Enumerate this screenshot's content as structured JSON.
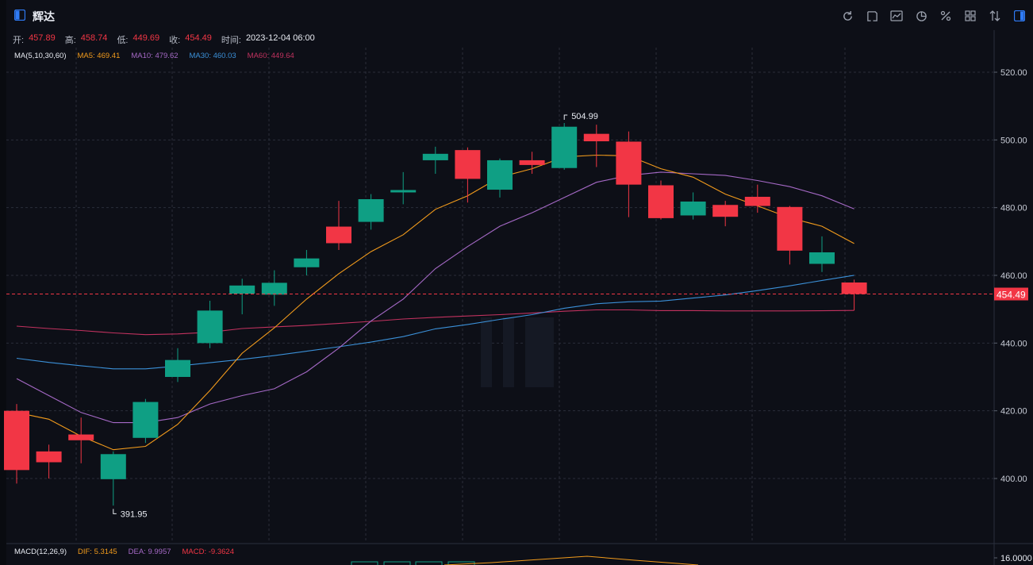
{
  "header": {
    "title": "辉达",
    "tools": [
      "refresh-icon",
      "draw-icon",
      "compare-icon",
      "pie-icon",
      "percent-icon",
      "grid-icon",
      "sort-icon",
      "layout-icon"
    ]
  },
  "ohlc": {
    "open_label": "开:",
    "open": "457.89",
    "high_label": "高:",
    "high": "458.74",
    "low_label": "低:",
    "low": "449.69",
    "close_label": "收:",
    "close": "454.49",
    "time_label": "时间:",
    "time": "2023-12-04 06:00"
  },
  "ma": {
    "label": "MA(5,10,30,60)",
    "ma5": "MA5: 469.41",
    "ma10": "MA10: 479.62",
    "ma30": "MA30: 460.03",
    "ma60": "MA60: 449.64"
  },
  "macd": {
    "label": "MACD(12,26,9)",
    "dif": "DIF: 5.3145",
    "dea": "DEA: 9.9957",
    "macd": "MACD: -9.3624",
    "axis_top": "16.0000"
  },
  "colors": {
    "up": "#0f9f84",
    "down": "#f23645",
    "ma5": "#f29b1c",
    "ma10": "#a569c6",
    "ma30": "#3b90d8",
    "ma60": "#c2325f"
  },
  "chart_data": {
    "type": "candlestick",
    "ylim": [
      380,
      528
    ],
    "y_ticks": [
      "520.00",
      "500.00",
      "480.00",
      "460.00",
      "440.00",
      "420.00",
      "400.00"
    ],
    "y_tick_values": [
      520,
      500,
      480,
      460,
      440,
      420,
      400
    ],
    "last_price": "454.49",
    "last_price_value": 454.49,
    "high_marker": "504.99",
    "high_marker_value": 504.99,
    "low_marker": "391.95",
    "low_marker_value": 391.95,
    "candles": [
      {
        "o": 420,
        "c": 402.5,
        "h": 422,
        "l": 398.5
      },
      {
        "o": 408,
        "c": 404.8,
        "h": 410,
        "l": 400
      },
      {
        "o": 413,
        "c": 411.3,
        "h": 418,
        "l": 404.5
      },
      {
        "o": 399.8,
        "c": 407.2,
        "h": 408,
        "l": 392
      },
      {
        "o": 412,
        "c": 422.6,
        "h": 423.5,
        "l": 410.5
      },
      {
        "o": 430,
        "c": 435,
        "h": 438.5,
        "l": 428.5
      },
      {
        "o": 440,
        "c": 449.6,
        "h": 452.5,
        "l": 438.5
      },
      {
        "o": 454.6,
        "c": 457,
        "h": 459,
        "l": 448.5
      },
      {
        "o": 454.3,
        "c": 457.8,
        "h": 461.5,
        "l": 451
      },
      {
        "o": 462.4,
        "c": 465,
        "h": 467.5,
        "l": 460
      },
      {
        "o": 474.4,
        "c": 469.5,
        "h": 482,
        "l": 467.5
      },
      {
        "o": 475.8,
        "c": 482.5,
        "h": 484,
        "l": 473.5
      },
      {
        "o": 484.5,
        "c": 485.2,
        "h": 490.5,
        "l": 481
      },
      {
        "o": 494,
        "c": 495.9,
        "h": 498,
        "l": 490
      },
      {
        "o": 497,
        "c": 488.5,
        "h": 497.8,
        "l": 481.5
      },
      {
        "o": 485.3,
        "c": 494,
        "h": 494.5,
        "l": 483
      },
      {
        "o": 494,
        "c": 492.6,
        "h": 496.5,
        "l": 490
      },
      {
        "o": 491.7,
        "c": 503.9,
        "h": 504.99,
        "l": 491.2
      },
      {
        "o": 501.8,
        "c": 499.6,
        "h": 504.5,
        "l": 492
      },
      {
        "o": 499.5,
        "c": 486.8,
        "h": 502.5,
        "l": 477.2
      },
      {
        "o": 486.6,
        "c": 476.9,
        "h": 488,
        "l": 476.5
      },
      {
        "o": 477.7,
        "c": 481.8,
        "h": 484.5,
        "l": 476.5
      },
      {
        "o": 480.8,
        "c": 477.3,
        "h": 482,
        "l": 474.5
      },
      {
        "o": 483.2,
        "c": 480.5,
        "h": 486.8,
        "l": 478.5
      },
      {
        "o": 480.2,
        "c": 467.3,
        "h": 480.5,
        "l": 463.2
      },
      {
        "o": 463.4,
        "c": 466.8,
        "h": 471.5,
        "l": 461
      },
      {
        "o": 457.89,
        "c": 454.49,
        "h": 458.74,
        "l": 449.69
      }
    ],
    "ma5": [
      419.5,
      417.5,
      412.5,
      408.5,
      409.5,
      416,
      426,
      437,
      444.5,
      453,
      460.5,
      467,
      472,
      479.5,
      483.5,
      489,
      491.5,
      495,
      495.5,
      495.3,
      491.5,
      489,
      484,
      480.5,
      477,
      474.5,
      469.41
    ],
    "ma10": [
      429.5,
      424.5,
      419.5,
      416.5,
      416.5,
      418,
      422,
      424.5,
      426.5,
      431.5,
      438.5,
      446.5,
      453,
      462,
      468.5,
      474.5,
      478.5,
      483,
      487.5,
      489.5,
      490.5,
      490,
      489.5,
      488,
      486.2,
      483.5,
      479.62
    ],
    "ma30": [
      435.5,
      434.3,
      433.3,
      432.4,
      432.4,
      433.2,
      434.2,
      435.2,
      436.3,
      437.6,
      438.9,
      440.3,
      441.9,
      444.2,
      445.5,
      447,
      448.4,
      450.3,
      451.6,
      452.2,
      452.4,
      453.3,
      454.2,
      455.5,
      456.9,
      458.5,
      460.03
    ],
    "ma60": [
      445,
      444.3,
      443.7,
      443,
      442.5,
      442.7,
      443.2,
      444.3,
      444.8,
      445.2,
      445.8,
      446.4,
      447.1,
      447.6,
      448,
      448.4,
      448.9,
      449.4,
      449.8,
      449.8,
      449.6,
      449.6,
      449.5,
      449.5,
      449.5,
      449.55,
      449.64
    ]
  }
}
